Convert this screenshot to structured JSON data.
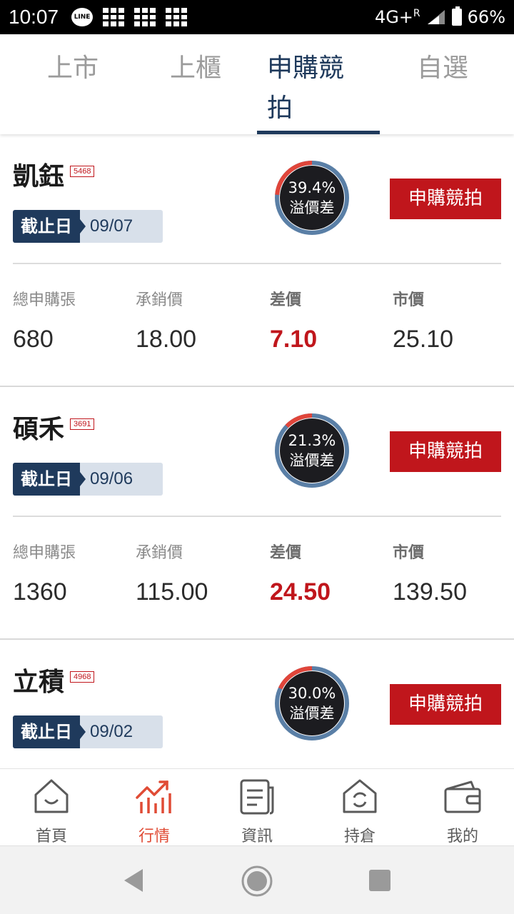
{
  "status_bar": {
    "time": "10:07",
    "line_label": "LINE",
    "network": "4G+",
    "roaming": "R",
    "battery": "66%"
  },
  "tabs": [
    {
      "label": "上市"
    },
    {
      "label": "上櫃"
    },
    {
      "label": "申購競拍",
      "active": true
    },
    {
      "label": "自選"
    }
  ],
  "card_labels": {
    "deadline": "截止日",
    "total": "總申購張",
    "underwriting": "承銷價",
    "spread": "差價",
    "market": "市價",
    "premium": "溢價差",
    "bid_button": "申購競拍"
  },
  "stocks": [
    {
      "name": "凱鈺",
      "code": "5468",
      "deadline": "09/07",
      "premium_pct": "39.4%",
      "premium_value": 39.4,
      "total": "680",
      "underwriting": "18.00",
      "spread": "7.10",
      "market": "25.10"
    },
    {
      "name": "碩禾",
      "code": "3691",
      "deadline": "09/06",
      "premium_pct": "21.3%",
      "premium_value": 21.3,
      "total": "1360",
      "underwriting": "115.00",
      "spread": "24.50",
      "market": "139.50"
    },
    {
      "name": "立積",
      "code": "4968",
      "deadline": "09/02",
      "premium_pct": "30.0%",
      "premium_value": 30.0
    }
  ],
  "bottom_nav": [
    {
      "label": "首頁",
      "icon": "home-icon"
    },
    {
      "label": "行情",
      "icon": "chart-icon",
      "active": true
    },
    {
      "label": "資訊",
      "icon": "news-icon"
    },
    {
      "label": "持倉",
      "icon": "holdings-icon"
    },
    {
      "label": "我的",
      "icon": "wallet-icon"
    }
  ],
  "colors": {
    "accent_red": "#c0161c",
    "navy": "#1f3a5c",
    "ring_track": "#5a7fa6",
    "ring_progress": "#e0453a",
    "nav_active": "#e04b35"
  }
}
